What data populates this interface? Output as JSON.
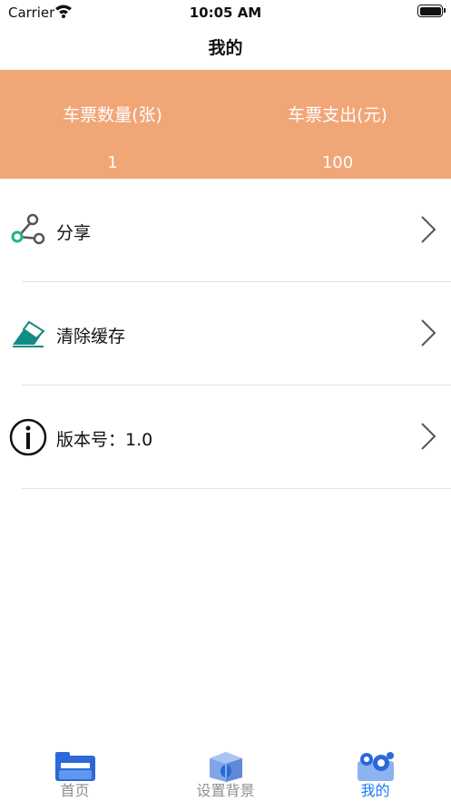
{
  "status_bar": {
    "carrier": "Carrier",
    "time": "10:05 AM"
  },
  "nav": {
    "title": "我的"
  },
  "stats": {
    "background_color": "#f1a678",
    "ticket_count": {
      "label": "车票数量(张)",
      "value": "1"
    },
    "ticket_expense": {
      "label": "车票支出(元)",
      "value": "100"
    }
  },
  "menu": {
    "items": [
      {
        "label": "分享",
        "icon": "share-icon"
      },
      {
        "label": "清除缓存",
        "icon": "eraser-icon"
      },
      {
        "label": "版本号：1.0",
        "icon": "info-icon"
      }
    ]
  },
  "tab_bar": {
    "active_color": "#1b7cf6",
    "tabs": [
      {
        "label": "首页",
        "icon": "folder-icon",
        "active": false
      },
      {
        "label": "设置背景",
        "icon": "cube-icon",
        "active": false
      },
      {
        "label": "我的",
        "icon": "gears-icon",
        "active": true
      }
    ]
  }
}
